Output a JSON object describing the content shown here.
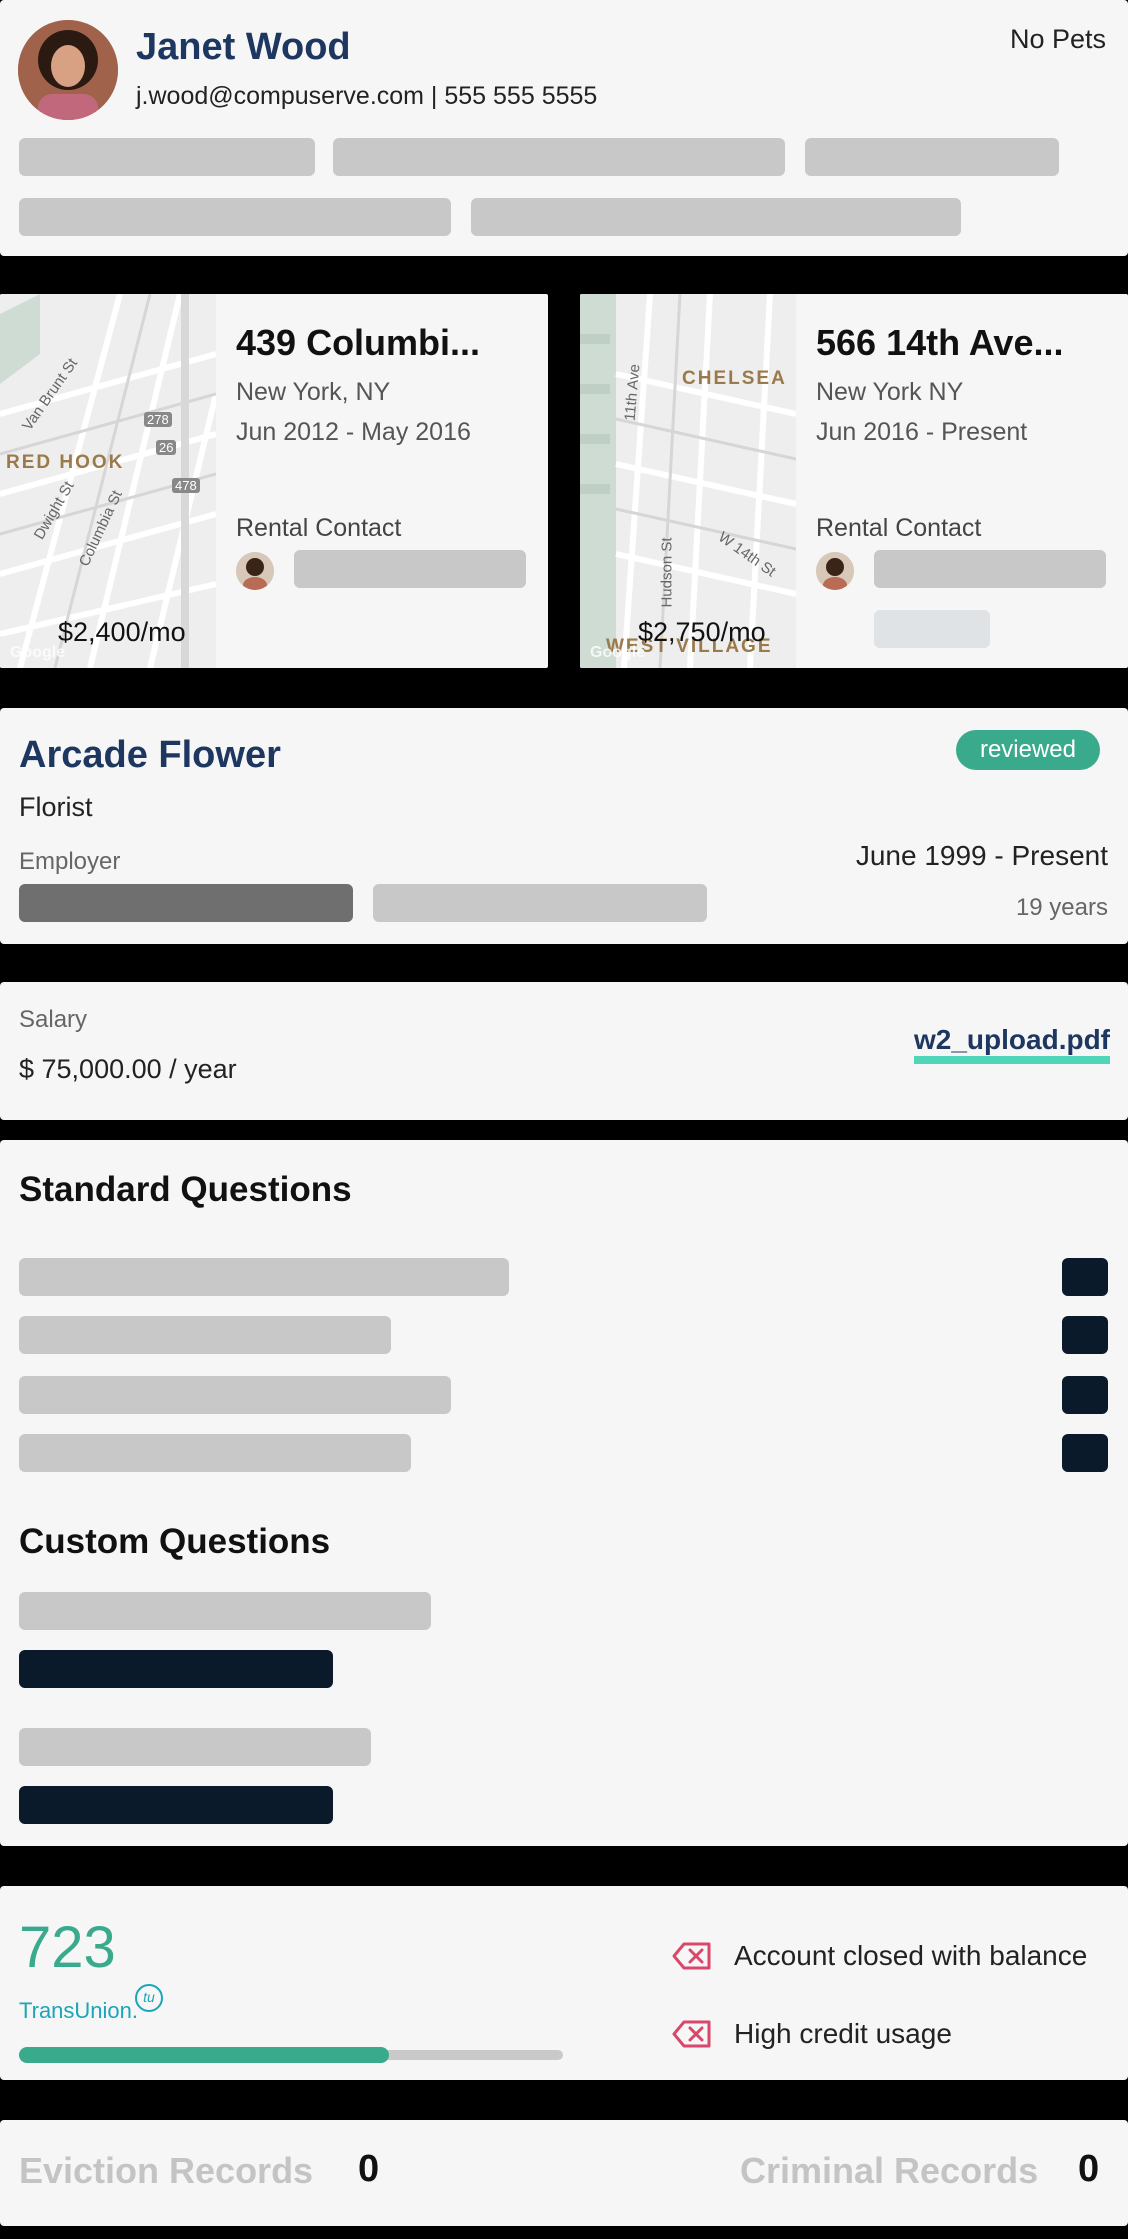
{
  "profile": {
    "name": "Janet Wood",
    "contact": "j.wood@compuserve.com | 555 555 5555",
    "pets": "No Pets"
  },
  "addresses": [
    {
      "title": "439 Columbi...",
      "city": "New York, NY",
      "dates": "Jun 2012 - May 2016",
      "rental_contact_label": "Rental Contact",
      "price": "$2,400/mo",
      "map_neighborhood": "RED HOOK",
      "map_streets": [
        "Van Brunt St",
        "Dwight St",
        "Columbia St"
      ],
      "map_shields": [
        "278",
        "26",
        "478"
      ],
      "map_credit": "Google"
    },
    {
      "title": "566 14th Ave...",
      "city": "New York NY",
      "dates": "Jun 2016 - Present",
      "rental_contact_label": "Rental Contact",
      "price": "$2,750/mo",
      "map_neighborhoods": [
        "CHELSEA",
        "WEST VILLAGE"
      ],
      "map_streets": [
        "11th Ave",
        "W 14th St",
        "Hudson St"
      ],
      "map_credit": "Google"
    }
  ],
  "employer": {
    "name": "Arcade Flower",
    "role": "Florist",
    "label": "Employer",
    "status": "reviewed",
    "dates": "June 1999 - Present",
    "years": "19 years"
  },
  "salary": {
    "label": "Salary",
    "value": "$ 75,000.00 / year",
    "file": "w2_upload.pdf"
  },
  "questions": {
    "standard_title": "Standard Questions",
    "custom_title": "Custom Questions"
  },
  "credit": {
    "score": "723",
    "bureau": "TransUnion.",
    "bureau_mark": "tu",
    "score_fraction": 0.68,
    "flags": [
      "Account closed with balance",
      "High credit usage"
    ],
    "colors": {
      "accent": "#3aaa8c",
      "flag": "#d9476a",
      "navy": "#1d3761"
    }
  },
  "records": {
    "eviction_label": "Eviction Records",
    "eviction_count": "0",
    "criminal_label": "Criminal Records",
    "criminal_count": "0"
  }
}
